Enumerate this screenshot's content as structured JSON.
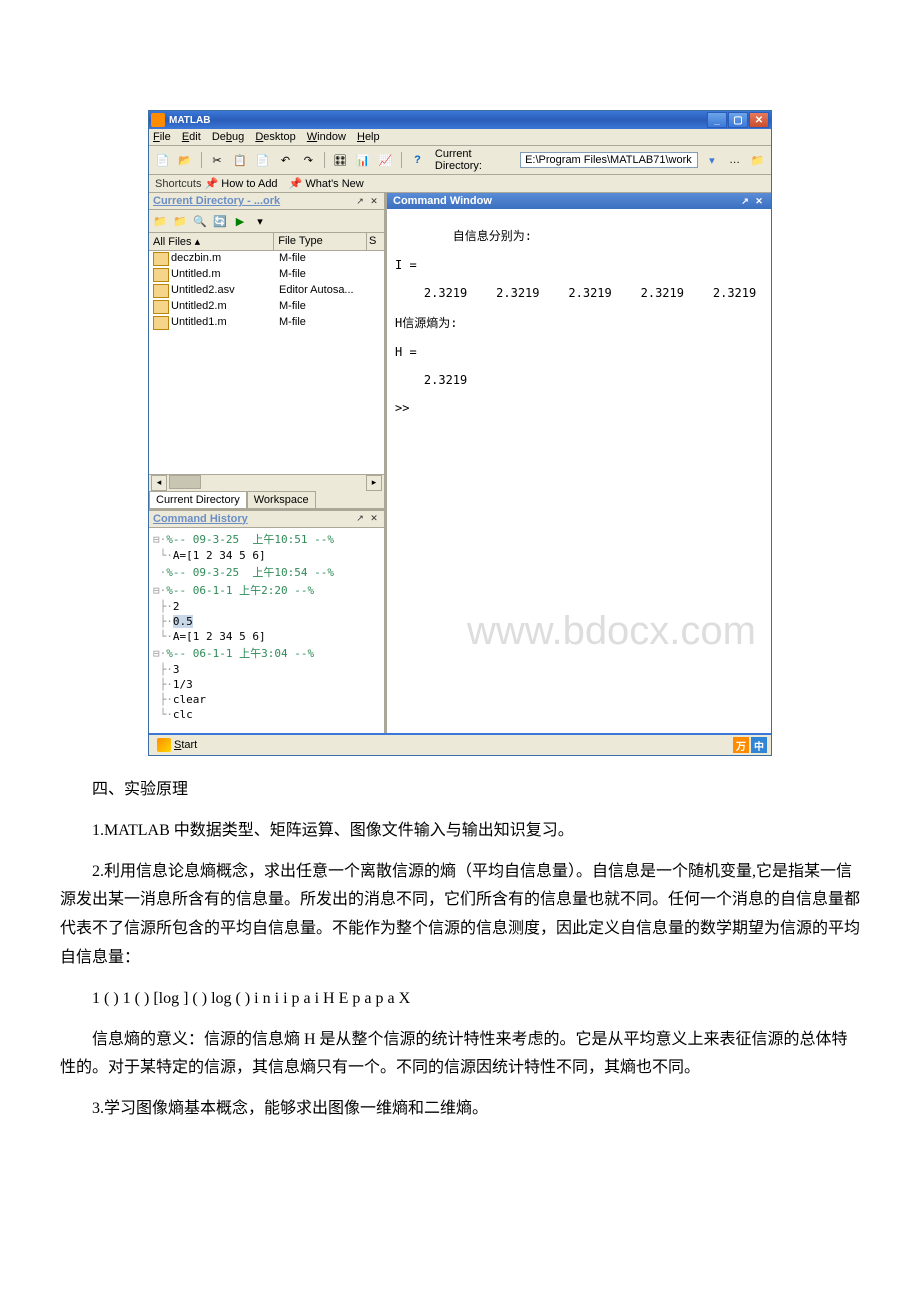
{
  "titlebar": {
    "app_name": "MATLAB"
  },
  "menubar": {
    "file": "File",
    "edit": "Edit",
    "debug": "Debug",
    "desktop": "Desktop",
    "window": "Window",
    "help": "Help"
  },
  "toolbar": {
    "dir_label": "Current Directory:",
    "dir_value": "E:\\Program Files\\MATLAB71\\work"
  },
  "shortcuts": {
    "label": "Shortcuts",
    "howto": "How to Add",
    "whatsnew": "What's New"
  },
  "curdir": {
    "title": "Current Directory - ...ork",
    "col_files": "All Files",
    "col_type": "File Type",
    "col_s": "S",
    "files": [
      {
        "name": "deczbin.m",
        "type": "M-file"
      },
      {
        "name": "Untitled.m",
        "type": "M-file"
      },
      {
        "name": "Untitled2.asv",
        "type": "Editor Autosa..."
      },
      {
        "name": "Untitled2.m",
        "type": "M-file"
      },
      {
        "name": "Untitled1.m",
        "type": "M-file"
      }
    ],
    "tab_cd": "Current Directory",
    "tab_ws": "Workspace"
  },
  "history": {
    "title": "Command History",
    "items": [
      {
        "text": "%-- 09-3-25  上午10:51 --%",
        "cls": "hist-sess",
        "prefix": "⊟·"
      },
      {
        "text": "A=[1 2 34 5 6]",
        "cls": "hist-cmd",
        "prefix": " └·"
      },
      {
        "text": "%-- 09-3-25  上午10:54 --%",
        "cls": "hist-sess",
        "prefix": " ·"
      },
      {
        "text": "%-- 06-1-1 上午2:20 --%",
        "cls": "hist-sess",
        "prefix": "⊟·"
      },
      {
        "text": "2",
        "cls": "hist-cmd",
        "prefix": " ├·"
      },
      {
        "text": "0.5",
        "cls": "hist-cmd hist-sel",
        "prefix": " ├·"
      },
      {
        "text": "A=[1 2 34 5 6]",
        "cls": "hist-cmd",
        "prefix": " └·"
      },
      {
        "text": "%-- 06-1-1 上午3:04 --%",
        "cls": "hist-sess",
        "prefix": "⊟·"
      },
      {
        "text": "3",
        "cls": "hist-cmd",
        "prefix": " ├·"
      },
      {
        "text": "1/3",
        "cls": "hist-cmd",
        "prefix": " ├·"
      },
      {
        "text": "clear",
        "cls": "hist-cmd",
        "prefix": " ├·"
      },
      {
        "text": "clc",
        "cls": "hist-cmd",
        "prefix": " └·"
      }
    ]
  },
  "cmdwin": {
    "title": "Command Window",
    "output": "自信息分别为:\n\nI =\n\n    2.3219    2.3219    2.3219    2.3219    2.3219\n\nH信源熵为:\n\nH =\n\n    2.3219\n\n>> "
  },
  "statusbar": {
    "start": "Start",
    "ime1": "万",
    "ime2": "中"
  },
  "watermark": "www.bdocx.com",
  "doc": {
    "p1": "四、实验原理",
    "p2": "1.MATLAB 中数据类型、矩阵运算、图像文件输入与输出知识复习。",
    "p3": "2.利用信息论息熵概念，求出任意一个离散信源的熵（平均自信息量）。自信息是一个随机变量,它是指某一信源发出某一消息所含有的信息量。所发出的消息不同，它们所含有的信息量也就不同。任何一个消息的自信息量都代表不了信源所包含的平均自信息量。不能作为整个信源的信息测度，因此定义自信息量的数学期望为信源的平均自信息量：",
    "p4": "1 ( ) 1 ( ) [log ] ( ) log ( ) i n i i p a i H E p a p a        X",
    "p5": "信息熵的意义：信源的信息熵 H 是从整个信源的统计特性来考虑的。它是从平均意义上来表征信源的总体特性的。对于某特定的信源，其信息熵只有一个。不同的信源因统计特性不同，其熵也不同。",
    "p6": "3.学习图像熵基本概念，能够求出图像一维熵和二维熵。"
  }
}
